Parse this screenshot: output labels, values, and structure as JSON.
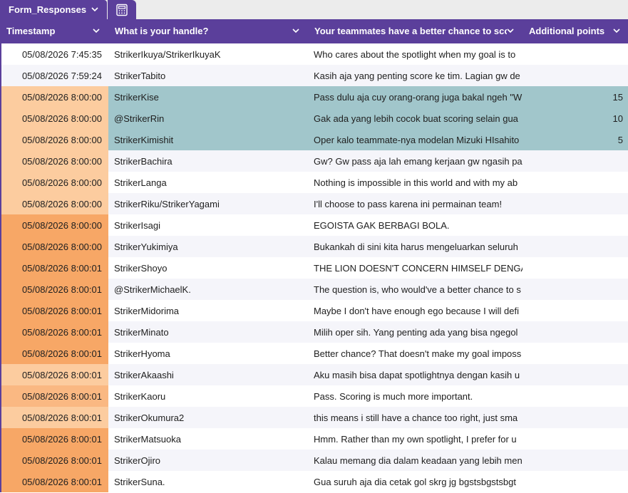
{
  "sheet_tab": {
    "label": "Form_Responses",
    "icon": "chevron-down-icon"
  },
  "form_icon": "form-grid-icon",
  "colors": {
    "header_bg": "#5b3f9b",
    "row_white": "#ffffff",
    "row_alt": "#f5f5fa",
    "highlight": "#a1c6cb",
    "ts_light": "#fccc9f",
    "ts_medium": "#fab882",
    "ts_dark": "#f7a766"
  },
  "columns": [
    {
      "label": "Timestamp"
    },
    {
      "label": "What is your handle?"
    },
    {
      "label": "Your teammates have a better chance to sco"
    },
    {
      "label": "Additional points"
    }
  ],
  "rows": [
    {
      "timestamp": "05/08/2026 7:45:35",
      "handle": "StrikerIkuya/StrikerIkuyaK",
      "answer": "Who cares about the spotlight when my goal is to",
      "points": "",
      "ts_shade": "none",
      "highlight": false
    },
    {
      "timestamp": "05/08/2026 7:59:24",
      "handle": "StrikerTabito",
      "answer": "Kasih aja yang penting score ke tim. Lagian gw de",
      "points": "",
      "ts_shade": "none",
      "highlight": false
    },
    {
      "timestamp": "05/08/2026 8:00:00",
      "handle": "StrikerKise",
      "answer": "Pass dulu aja cuy orang-orang juga bakal ngeh \"W",
      "points": "15",
      "ts_shade": "light",
      "highlight": true
    },
    {
      "timestamp": "05/08/2026 8:00:00",
      "handle": "@StrikerRin",
      "answer": "Gak ada yang lebih cocok buat scoring selain gua",
      "points": "10",
      "ts_shade": "light",
      "highlight": true
    },
    {
      "timestamp": "05/08/2026 8:00:00",
      "handle": "StrikerKimishit",
      "answer": "Oper kalo teammate-nya modelan Mizuki HIsahito",
      "points": "5",
      "ts_shade": "light",
      "highlight": true
    },
    {
      "timestamp": "05/08/2026 8:00:00",
      "handle": "StrikerBachira",
      "answer": "Gw? Gw pass aja lah emang kerjaan gw ngasih pa",
      "points": "",
      "ts_shade": "light",
      "highlight": false
    },
    {
      "timestamp": "05/08/2026 8:00:00",
      "handle": "StrikerLanga",
      "answer": "Nothing is impossible in this world and with my ab",
      "points": "",
      "ts_shade": "light",
      "highlight": false
    },
    {
      "timestamp": "05/08/2026 8:00:00",
      "handle": "StrikerRiku/StrikerYagami",
      "answer": "I'll choose to pass karena ini permainan team!",
      "points": "",
      "ts_shade": "light",
      "highlight": false
    },
    {
      "timestamp": "05/08/2026 8:00:00",
      "handle": "StrikerIsagi",
      "answer": "EGOISTA GAK BERBAGI BOLA.",
      "points": "",
      "ts_shade": "dark",
      "highlight": false
    },
    {
      "timestamp": "05/08/2026 8:00:00",
      "handle": "StrikerYukimiya",
      "answer": "Bukankah di sini kita harus mengeluarkan seluruh",
      "points": "",
      "ts_shade": "dark",
      "highlight": false
    },
    {
      "timestamp": "05/08/2026 8:00:01",
      "handle": "StrikerShoyo",
      "answer": "THE LION DOESN'T CONCERN HIMSELF DENGAN",
      "points": "",
      "ts_shade": "dark",
      "highlight": false
    },
    {
      "timestamp": "05/08/2026 8:00:01",
      "handle": "@StrikerMichaelK.",
      "answer": "The question is, who would've a better chance to s",
      "points": "",
      "ts_shade": "dark",
      "highlight": false
    },
    {
      "timestamp": "05/08/2026 8:00:01",
      "handle": "StrikerMidorima",
      "answer": "Maybe I don't have enough ego because I will defi",
      "points": "",
      "ts_shade": "dark",
      "highlight": false
    },
    {
      "timestamp": "05/08/2026 8:00:01",
      "handle": "StrikerMinato",
      "answer": "Milih oper sih. Yang penting ada yang bisa ngegol",
      "points": "",
      "ts_shade": "dark",
      "highlight": false
    },
    {
      "timestamp": "05/08/2026 8:00:01",
      "handle": "StrikerHyoma",
      "answer": "Better chance? That doesn't make my goal imposs",
      "points": "",
      "ts_shade": "dark",
      "highlight": false
    },
    {
      "timestamp": "05/08/2026 8:00:01",
      "handle": "StrikerAkaashi",
      "answer": "Aku masih bisa dapat spotlightnya dengan kasih u",
      "points": "",
      "ts_shade": "light",
      "highlight": false
    },
    {
      "timestamp": "05/08/2026 8:00:01",
      "handle": "StrikerKaoru",
      "answer": "Pass. Scoring is much more important.",
      "points": "",
      "ts_shade": "medium",
      "highlight": false
    },
    {
      "timestamp": "05/08/2026 8:00:01",
      "handle": "StrikerOkumura2",
      "answer": "this means i still have a chance too right, just sma",
      "points": "",
      "ts_shade": "light",
      "highlight": false
    },
    {
      "timestamp": "05/08/2026 8:00:01",
      "handle": "StrikerMatsuoka",
      "answer": "Hmm. Rather than my own spotlight, I prefer for u",
      "points": "",
      "ts_shade": "dark",
      "highlight": false
    },
    {
      "timestamp": "05/08/2026 8:00:01",
      "handle": "StrikerOjiro",
      "answer": "Kalau memang dia dalam keadaan yang lebih men",
      "points": "",
      "ts_shade": "dark",
      "highlight": false
    },
    {
      "timestamp": "05/08/2026 8:00:01",
      "handle": "StrikerSuna.",
      "answer": "Gua suruh aja dia cetak gol skrg jg bgstsbgstsbgt",
      "points": "",
      "ts_shade": "dark",
      "highlight": false
    }
  ]
}
